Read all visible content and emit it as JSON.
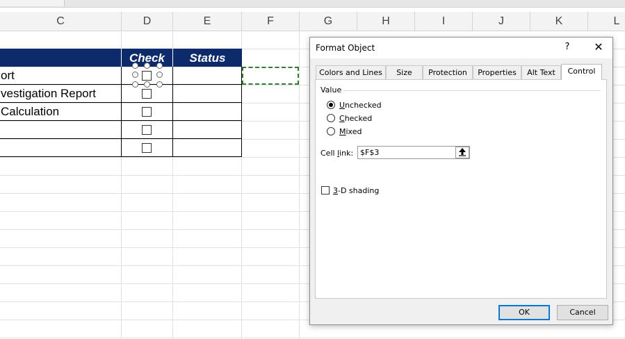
{
  "sheet": {
    "columns": [
      "C",
      "D",
      "E",
      "F",
      "G",
      "H",
      "I",
      "J",
      "K",
      "L"
    ],
    "table": {
      "headers": [
        "Check",
        "Status"
      ],
      "rows": [
        {
          "label": "ort"
        },
        {
          "label": "vestigation Report"
        },
        {
          "label": "Calculation"
        },
        {
          "label": ""
        },
        {
          "label": ""
        }
      ]
    },
    "colors": {
      "header_bg": "#0d2a6b",
      "selection_border": "#2e7d32"
    }
  },
  "dialog": {
    "title": "Format Object",
    "help_icon": "?",
    "close_icon": "✕",
    "tabs": [
      "Colors and Lines",
      "Size",
      "Protection",
      "Properties",
      "Alt Text",
      "Control"
    ],
    "active_tab": "Control",
    "value_group_label": "Value",
    "radios": [
      {
        "pre": "",
        "key": "U",
        "post": "nchecked",
        "checked": true
      },
      {
        "pre": "",
        "key": "C",
        "post": "hecked",
        "checked": false
      },
      {
        "pre": "",
        "key": "M",
        "post": "ixed",
        "checked": false
      }
    ],
    "cell_link": {
      "label_pre": "Cell ",
      "label_key": "l",
      "label_post": "ink:",
      "value": "$F$3",
      "button_icon": "collapse-arrow-up-icon"
    },
    "shading": {
      "key": "3",
      "post": "-D shading",
      "checked": false
    },
    "ok_label": "OK",
    "cancel_label": "Cancel"
  }
}
